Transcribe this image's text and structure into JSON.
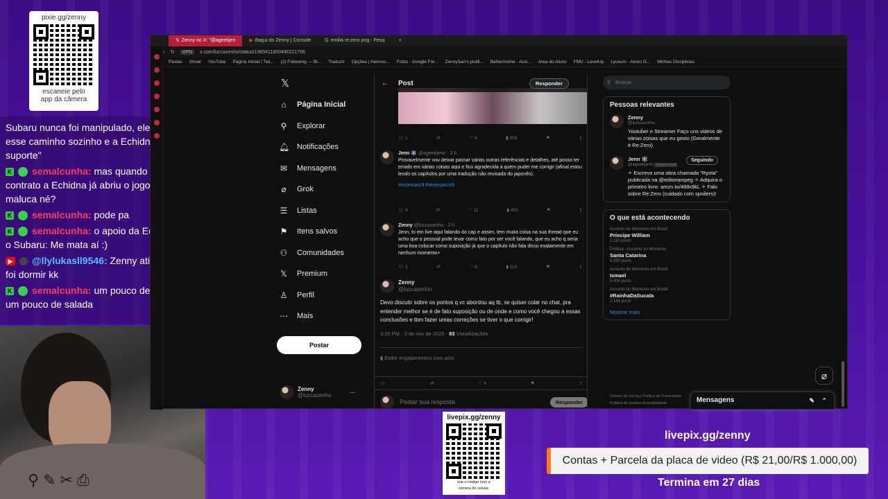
{
  "overlay": {
    "qr_top": {
      "title": "pixie.gg/zenny",
      "caption_l1": "escaneie pelo",
      "caption_l2": "app da câmera"
    },
    "chat": [
      {
        "user": "",
        "text": "Subaru nunca foi manipulado, ele foi por esse caminho sozinho e a Echidna só deu suporte\""
      },
      {
        "user": "semalcunha:",
        "text": " mas quando ele faz o contrato a Echidna já abriu o jogo que é maluca né?"
      },
      {
        "user": "semalcunha:",
        "text": " pode pa"
      },
      {
        "user": "semalcunha:",
        "text": " o apoio da Echidna com o Subaru: Me mata aí :)"
      },
      {
        "user": "@llylukasll9546:",
        "text": " Zenny ativou a live e foi dormir kk"
      },
      {
        "user": "semalcunha:",
        "text": " um pouco de droga e um pouco de salada"
      }
    ],
    "qr_bottom": {
      "title": "livepix.gg/zenny",
      "caption_l1": "leia o código com a",
      "caption_l2": "câmera do celular."
    },
    "livepix_url": "livepix.gg/zenny",
    "goal_text": "Contas + Parcela da placa de video (R$ 21,00/R$ 1.000,00)",
    "goal_sub": "Termina em 27 dias"
  },
  "browser": {
    "tabs": [
      "Zenny no X: \"@ageekjen",
      "Bagui do Zenny | Console",
      "emilia re:zero png - Pesq"
    ],
    "url": "x.com/luccazenho/status/1985411800490221706",
    "bookmarks": [
      "Pastas",
      "Gmail",
      "YouTube",
      "Página Inicial / Twi...",
      "(2) Following — Bl...",
      "Traduzir",
      "Opções | Aternos...",
      "Fotos - Google Fot...",
      "ZennySan's profil...",
      "BetterAnime - Assi...",
      "Area do Aluno",
      "FMU - LevelUp",
      "Lyceum - Aluno O...",
      "Minhas Disciplinas"
    ]
  },
  "nav": {
    "items": [
      "Página Inicial",
      "Explorar",
      "Notificações",
      "Mensagens",
      "Grok",
      "Listas",
      "Itens salvos",
      "Comunidades",
      "Premium",
      "Perfil",
      "Mais"
    ],
    "post_button": "Postar",
    "me_name": "Zenny",
    "me_handle": "@luccazenho"
  },
  "post": {
    "header": "Post",
    "reply_btn": "Responder",
    "top_actions": {
      "replies": "1",
      "likes": "9",
      "views": "359"
    },
    "t1": {
      "name": "Jenn ❄️",
      "handle": "@ageekjenn · 2 h",
      "body": "Provavelmente vou deixar passar várias outras referências e detalhes, até posso ter errado em várias coisas aqui e fico agradecida a quem puder me corrigir (afinal estou lendo os capítulos por uma tradução não revisada do japonês).",
      "tags": "#rezeroarc9 #rezeroarco9",
      "replies": "4",
      "likes": "11",
      "views": "455"
    },
    "t2": {
      "name": "Zenny",
      "handle": "@luccazenho · 2 h",
      "body": "Jenn, to em live aqui falando do cap e assim, tem muita coisa na sua thread que eu acho que o pessoal pode levar como fato por ser você falando, que eu acho q seria uma boa colocar como suposição já que o capítulo não fala disso exatamente em nenhum momento+",
      "replies": "1",
      "likes": "6",
      "views": "113"
    },
    "main": {
      "name": "Zenny",
      "handle": "@luccazenho",
      "body": "Devo discutir sobre os pontos q vc abordou aq tb, se quiser colar no chat, pra entender melhor se é de fato suposição ou de onde e como você chegou a essas conclusões e tbm fazer umas correções se tiver o que corrigir!",
      "meta": "3:20 PM · 3 de nov de 2025 · ",
      "views": "83",
      "views_label": " Visualizações",
      "engagement": "Exibir engajamentos com post",
      "likes": "4"
    },
    "reply_placeholder": "Postar sua resposta",
    "reply_submit": "Responder"
  },
  "right": {
    "search_placeholder": "Buscar",
    "relevant_title": "Pessoas relevantes",
    "p1": {
      "name": "Zenny",
      "handle": "@luccazenho",
      "bio": "Youtuber e Streamer Faço uns videos de várias coisas que eu gosto (Geralmente é Re:Zero)"
    },
    "p2": {
      "name": "Jenn ❄️",
      "handle": "@ageekjenn",
      "follows": "Segue você",
      "follow_btn": "Seguindo",
      "bio": "✧ Escrevo uma obra chamada \"Ryota\" publicada na @editorampeg ✧ Adquira o primeiro livro: amzn.to/488x9kL ✧ Falo sobre Re:Zero (cuidado com spoilers)!"
    },
    "trends_title": "O que está acontecendo",
    "trends": [
      {
        "cat": "Assunto do Momento em Brasil",
        "title": "Príncipe William",
        "count": "1.110 posts"
      },
      {
        "cat": "Política · Assunto do Momento",
        "title": "Santa Catarina",
        "count": "8.330 posts"
      },
      {
        "cat": "Assunto do Momento em Brasil",
        "title": "Ismael",
        "count": "5.404 posts"
      },
      {
        "cat": "Assunto do Momento em Brasil",
        "title": "#RainhaDaSucata",
        "count": "2.149 posts"
      }
    ],
    "show_more": "Mostrar mais",
    "footer": "Termos de Serviço  Política de Privacidade  Política de cookies  Acessibilidade",
    "messages": "Mensagens"
  }
}
